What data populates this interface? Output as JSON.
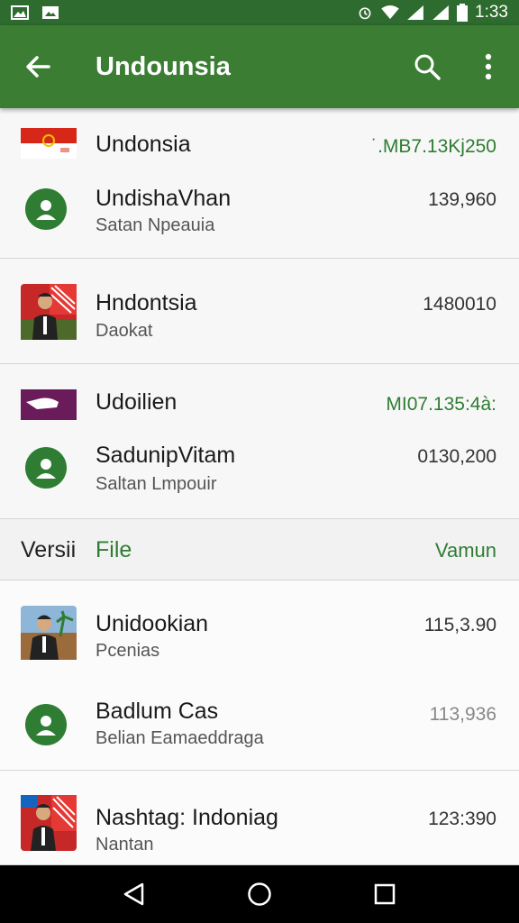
{
  "status_bar": {
    "time": "1:33"
  },
  "app_bar": {
    "title": "Undounsia"
  },
  "items": [
    {
      "primary": "Undonsia",
      "amount": "˙.MB7.13Kj250"
    },
    {
      "primary": "UndishaVhan",
      "secondary": "Satan Npeauia",
      "amount": "139,960"
    },
    {
      "primary": "Hndontsia",
      "secondary": "Daokat",
      "amount": "1480010"
    },
    {
      "primary": "Udoilien",
      "amount": "MI07.135:4à:"
    },
    {
      "primary": "SadunipVitam",
      "secondary": "Saltan Lmpouir",
      "amount": "0130,200"
    },
    {
      "primary": "Unidookian",
      "secondary": "Pcenias",
      "amount": "115,3.90"
    },
    {
      "primary": "Badlum Cas",
      "secondary": "Belian Eamaeddraga",
      "amount": "113,936"
    },
    {
      "primary": "Nashtag: Indoniag",
      "secondary": "Nantan",
      "amount": "123:390"
    }
  ],
  "section_header": {
    "col1": "Versii",
    "col2": "File",
    "col3": "Vamun"
  },
  "colors": {
    "primary": "#3a7d33",
    "status": "#2e6b2f",
    "accent": "#2e7d32"
  }
}
